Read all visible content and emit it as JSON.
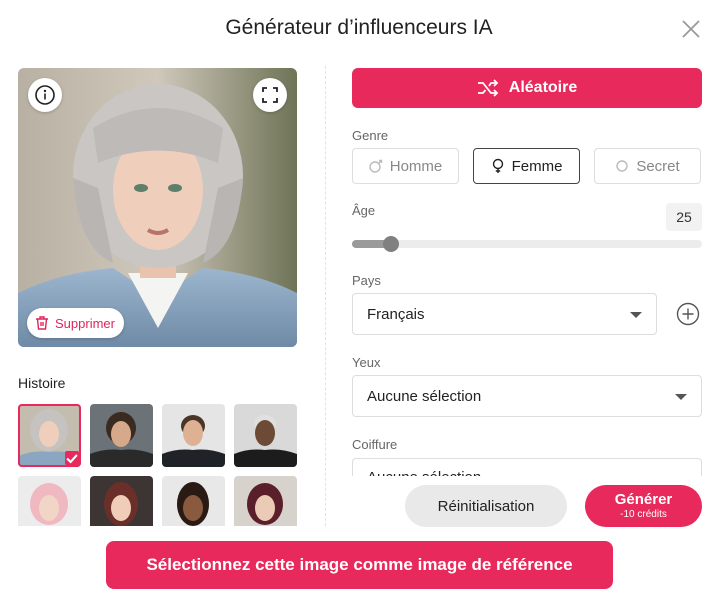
{
  "title": "Générateur d’influenceurs IA",
  "icons": {
    "close": "close-icon",
    "info": "info-icon",
    "expand": "expand-icon",
    "trash": "trash-icon",
    "shuffle": "shuffle-icon",
    "plus": "plus-circle-icon",
    "check": "check-icon"
  },
  "preview": {
    "delete_label": "Supprimer"
  },
  "history": {
    "label": "Histoire",
    "thumbnails_count": 8,
    "selected_index": 0
  },
  "random_button": {
    "label": "Aléatoire"
  },
  "gender": {
    "label": "Genre",
    "options": [
      {
        "label": "Homme",
        "active": false
      },
      {
        "label": "Femme",
        "active": true
      },
      {
        "label": "Secret",
        "active": false
      }
    ]
  },
  "age": {
    "label": "Âge",
    "value": "25",
    "fraction": 0.11
  },
  "country": {
    "label": "Pays",
    "value": "Français"
  },
  "eyes": {
    "label": "Yeux",
    "value": "Aucune sélection"
  },
  "hairstyle": {
    "label": "Coiffure",
    "value": "Aucune sélection"
  },
  "footer": {
    "reset_label": "Réinitialisation",
    "generate_label": "Générer",
    "generate_cost": "-10 crédits"
  },
  "reference_button": {
    "label": "Sélectionnez cette image comme image de référence"
  },
  "colors": {
    "accent": "#e8295c",
    "border": "#dddddd",
    "muted": "#e9e9e9"
  }
}
